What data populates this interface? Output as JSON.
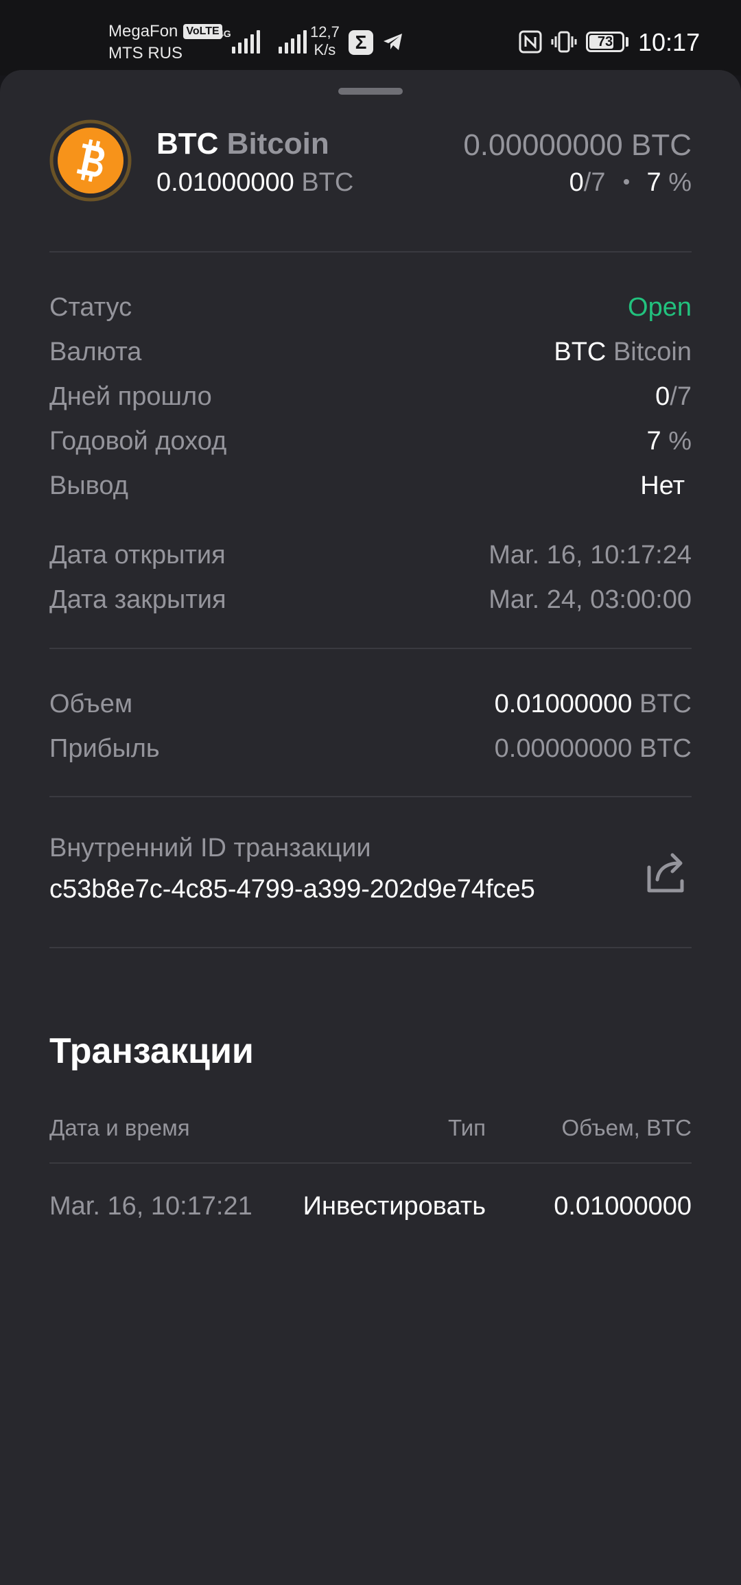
{
  "status_bar": {
    "carrier_1": "MegaFon",
    "volte": "VoLTE",
    "carrier_2": "MTS RUS",
    "network": "4G",
    "speed_value": "12,7",
    "speed_unit": "K/s",
    "battery": "73",
    "time": "10:17"
  },
  "header": {
    "coin_ticker": "BTC",
    "coin_name": "Bitcoin",
    "amount": "0.01000000",
    "amount_unit": "BTC",
    "balance": "0.00000000 BTC",
    "days_passed": "0",
    "days_total": "/7",
    "rate": "7",
    "rate_unit": "%"
  },
  "details": {
    "status_label": "Статус",
    "status_value": "Open",
    "currency_label": "Валюта",
    "currency_ticker": "BTC",
    "currency_name": "Bitcoin",
    "days_label": "Дней прошло",
    "days_passed": "0",
    "days_total": "/7",
    "apy_label": "Годовой доход",
    "apy_value": "7",
    "apy_unit": "%",
    "withdraw_label": "Вывод",
    "withdraw_value": "Нет",
    "open_date_label": "Дата открытия",
    "open_date_value": "Mar. 16, 10:17:24",
    "close_date_label": "Дата закрытия",
    "close_date_value": "Mar. 24, 03:00:00",
    "volume_label": "Объем",
    "volume_value": "0.01000000",
    "volume_unit": "BTC",
    "profit_label": "Прибыль",
    "profit_value": "0.00000000 BTC"
  },
  "transaction_id": {
    "label": "Внутренний ID транзакции",
    "value": "c53b8e7c-4c85-4799-a399-202d9e74fce5"
  },
  "transactions": {
    "title": "Транзакции",
    "columns": [
      "Дата и время",
      "Тип",
      "Объем, BTC"
    ],
    "rows": [
      {
        "date": "Mar. 16, 10:17:21",
        "type": "Инвестировать",
        "volume": "0.01000000"
      }
    ]
  },
  "colors": {
    "sheet_bg": "#28282d",
    "accent_green": "#22c27e",
    "bitcoin_orange": "#f7931a",
    "muted_text": "#95959c"
  },
  "icons": {
    "coin": "bitcoin-icon",
    "share": "share-icon"
  }
}
